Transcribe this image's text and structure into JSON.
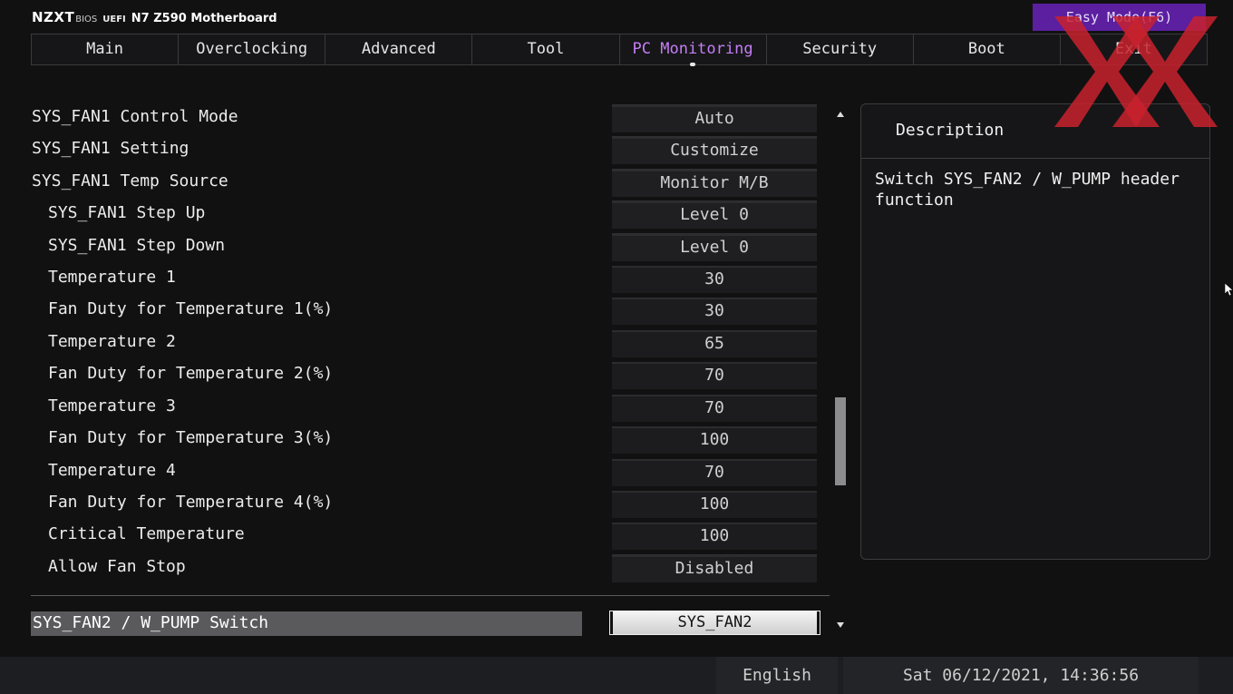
{
  "header": {
    "logo": "NZXT",
    "bios_label": "BIOS",
    "uefi_label": "UEFI",
    "model": "N7 Z590 Motherboard",
    "easy_mode": "Easy Mode(F6)"
  },
  "tabs": [
    {
      "label": "Main"
    },
    {
      "label": "Overclocking"
    },
    {
      "label": "Advanced"
    },
    {
      "label": "Tool"
    },
    {
      "label": "PC Monitoring",
      "active": true
    },
    {
      "label": "Security"
    },
    {
      "label": "Boot"
    },
    {
      "label": "Exit"
    }
  ],
  "settings": [
    {
      "label": "SYS_FAN1 Control Mode",
      "value": "Auto"
    },
    {
      "label": "SYS_FAN1 Setting",
      "value": "Customize"
    },
    {
      "label": "SYS_FAN1 Temp Source",
      "value": "Monitor M/B"
    },
    {
      "label": "SYS_FAN1 Step Up",
      "value": "Level 0"
    },
    {
      "label": "SYS_FAN1 Step Down",
      "value": "Level 0"
    },
    {
      "label": "Temperature 1",
      "value": "30"
    },
    {
      "label": "Fan Duty for Temperature 1(%)",
      "value": "30"
    },
    {
      "label": "Temperature 2",
      "value": "65"
    },
    {
      "label": "Fan Duty for Temperature 2(%)",
      "value": "70"
    },
    {
      "label": "Temperature 3",
      "value": "70"
    },
    {
      "label": "Fan Duty for Temperature 3(%)",
      "value": "100"
    },
    {
      "label": "Temperature 4",
      "value": "70"
    },
    {
      "label": "Fan Duty for Temperature 4(%)",
      "value": "100"
    },
    {
      "label": "Critical Temperature",
      "value": "100"
    },
    {
      "label": "Allow Fan Stop",
      "value": "Disabled"
    }
  ],
  "selected_setting": {
    "label": "SYS_FAN2 / W_PUMP Switch",
    "value": "SYS_FAN2"
  },
  "description": {
    "title": "Description",
    "text": "Switch SYS_FAN2 / W_PUMP header function"
  },
  "status": {
    "language": "English",
    "datetime": "Sat 06/12/2021, 14:36:56"
  },
  "colors": {
    "accent_purple": "#c57ef5",
    "easy_mode_bg": "#5b1fa0",
    "watermark_red": "#c8222e"
  },
  "icons": {
    "watermark": "hardwareluxx-xx-watermark",
    "cursor": "mouse-pointer-icon"
  }
}
